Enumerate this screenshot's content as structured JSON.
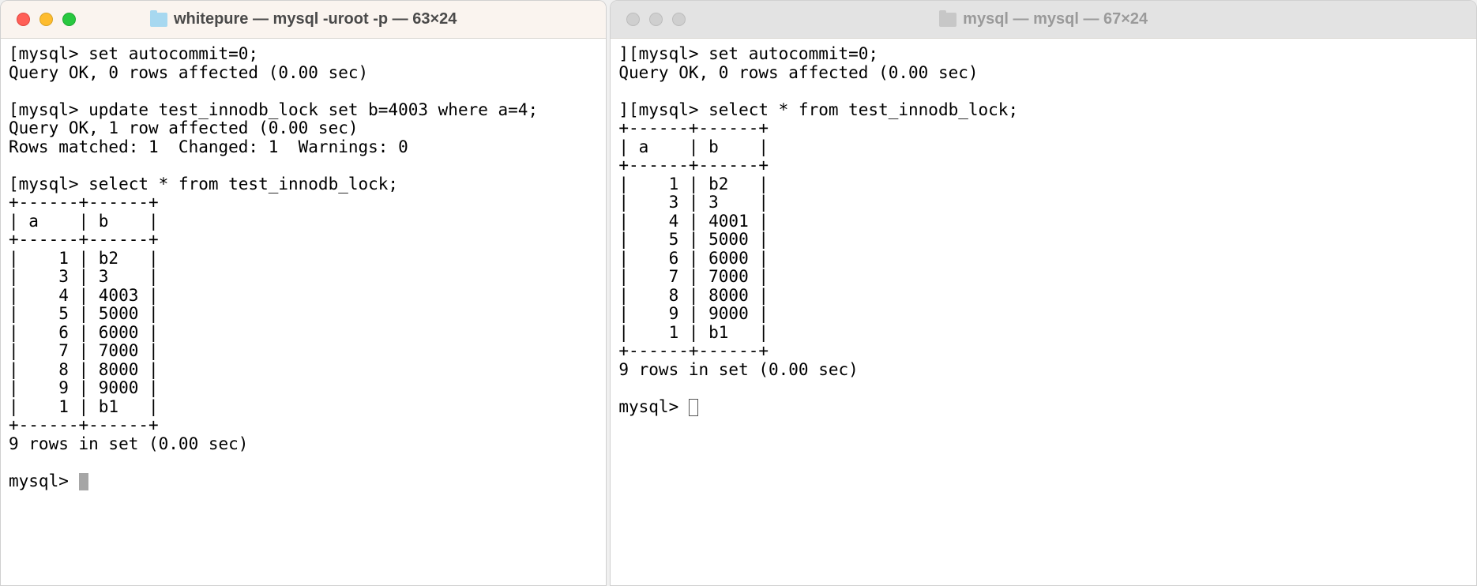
{
  "left": {
    "title": "whitepure — mysql -uroot -p — 63×24",
    "lines": {
      "l1": "[mysql> set autocommit=0;",
      "l2": "Query OK, 0 rows affected (0.00 sec)",
      "l3": "",
      "l4": "[mysql> update test_innodb_lock set b=4003 where a=4;",
      "l5": "Query OK, 1 row affected (0.00 sec)",
      "l6": "Rows matched: 1  Changed: 1  Warnings: 0",
      "l7": "",
      "l8": "[mysql> select * from test_innodb_lock;",
      "l9": "+------+------+",
      "l10": "| a    | b    |",
      "l11": "+------+------+",
      "l12": "|    1 | b2   |",
      "l13": "|    3 | 3    |",
      "l14": "|    4 | 4003 |",
      "l15": "|    5 | 5000 |",
      "l16": "|    6 | 6000 |",
      "l17": "|    7 | 7000 |",
      "l18": "|    8 | 8000 |",
      "l19": "|    9 | 9000 |",
      "l20": "|    1 | b1   |",
      "l21": "+------+------+",
      "l22": "9 rows in set (0.00 sec)",
      "l23": "",
      "l24": "mysql> "
    }
  },
  "right": {
    "title": "mysql — mysql — 67×24",
    "lines": {
      "l1": "][mysql> set autocommit=0;",
      "l2": "Query OK, 0 rows affected (0.00 sec)",
      "l3": "",
      "l4": "][mysql> select * from test_innodb_lock;",
      "l5": "+------+------+",
      "l6": "| a    | b    |",
      "l7": "+------+------+",
      "l8": "|    1 | b2   |",
      "l9": "|    3 | 3    |",
      "l10": "|    4 | 4001 |",
      "l11": "|    5 | 5000 |",
      "l12": "|    6 | 6000 |",
      "l13": "|    7 | 7000 |",
      "l14": "|    8 | 8000 |",
      "l15": "|    9 | 9000 |",
      "l16": "|    1 | b1   |",
      "l17": "+------+------+",
      "l18": "9 rows in set (0.00 sec)",
      "l19": "",
      "l20": "mysql> "
    }
  }
}
